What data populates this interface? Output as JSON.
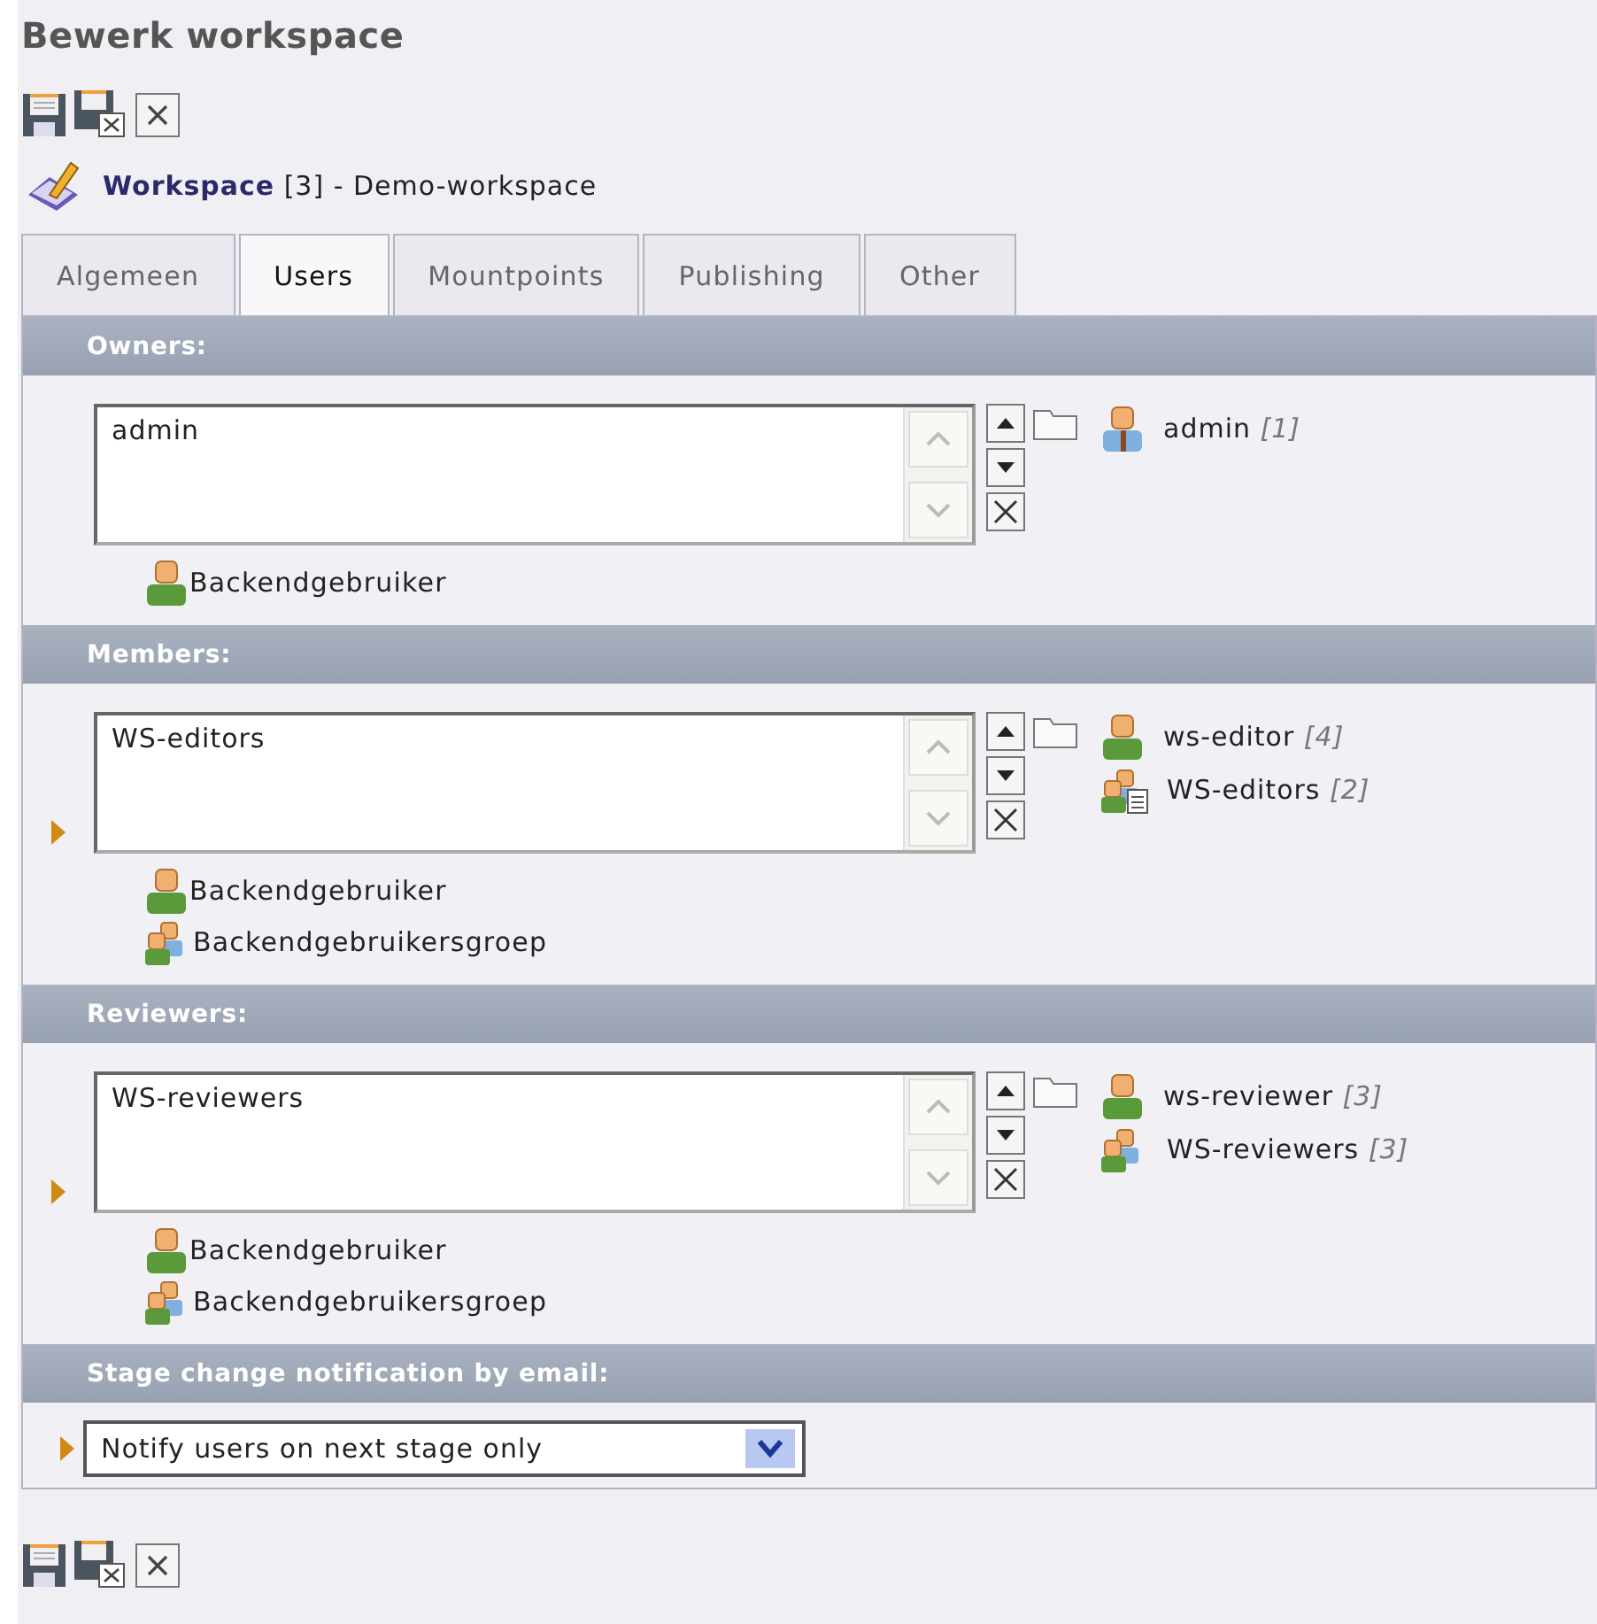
{
  "page_title": "Bewerk workspace",
  "toolbar_top": [
    {
      "kind": "save"
    },
    {
      "kind": "save-close"
    },
    {
      "kind": "close"
    }
  ],
  "record": {
    "text": "**Workspace** [3] - Demo-workspace"
  },
  "tabs": [
    {
      "label": "Algemeen",
      "selected": false
    },
    {
      "label": "Users",
      "selected": true
    },
    {
      "label": "Mountpoints",
      "selected": false
    },
    {
      "label": "Publishing",
      "selected": false
    },
    {
      "label": "Other",
      "selected": false
    }
  ],
  "sections": [
    {
      "kind": "group",
      "title": "Owners:",
      "marker": false,
      "selected_items": [
        "admin"
      ],
      "records": [
        {
          "kind": "admin",
          "text": "admin *[1]*"
        }
      ],
      "allowed": [
        {
          "kind": "user",
          "label": "Backendgebruiker"
        }
      ]
    },
    {
      "kind": "group",
      "title": "Members:",
      "marker": true,
      "selected_items": [
        "WS-editors"
      ],
      "records": [
        {
          "kind": "user",
          "text": "ws-editor *[4]*"
        },
        {
          "kind": "group-list",
          "text": "WS-editors *[2]*"
        }
      ],
      "allowed": [
        {
          "kind": "user",
          "label": "Backendgebruiker"
        },
        {
          "kind": "group",
          "label": "Backendgebruikersgroep"
        }
      ]
    },
    {
      "kind": "group",
      "title": "Reviewers:",
      "marker": true,
      "selected_items": [
        "WS-reviewers"
      ],
      "records": [
        {
          "kind": "user",
          "text": "ws-reviewer *[3]*"
        },
        {
          "kind": "group",
          "text": "WS-reviewers *[3]*"
        }
      ],
      "allowed": [
        {
          "kind": "user",
          "label": "Backendgebruiker"
        },
        {
          "kind": "group",
          "label": "Backendgebruikersgroep"
        }
      ]
    },
    {
      "kind": "select",
      "title": "Stage change notification by email:",
      "marker": true,
      "value": "Notify users on next stage only"
    }
  ],
  "toolbar_bottom": [
    {
      "kind": "save"
    },
    {
      "kind": "save-close"
    },
    {
      "kind": "close"
    }
  ]
}
